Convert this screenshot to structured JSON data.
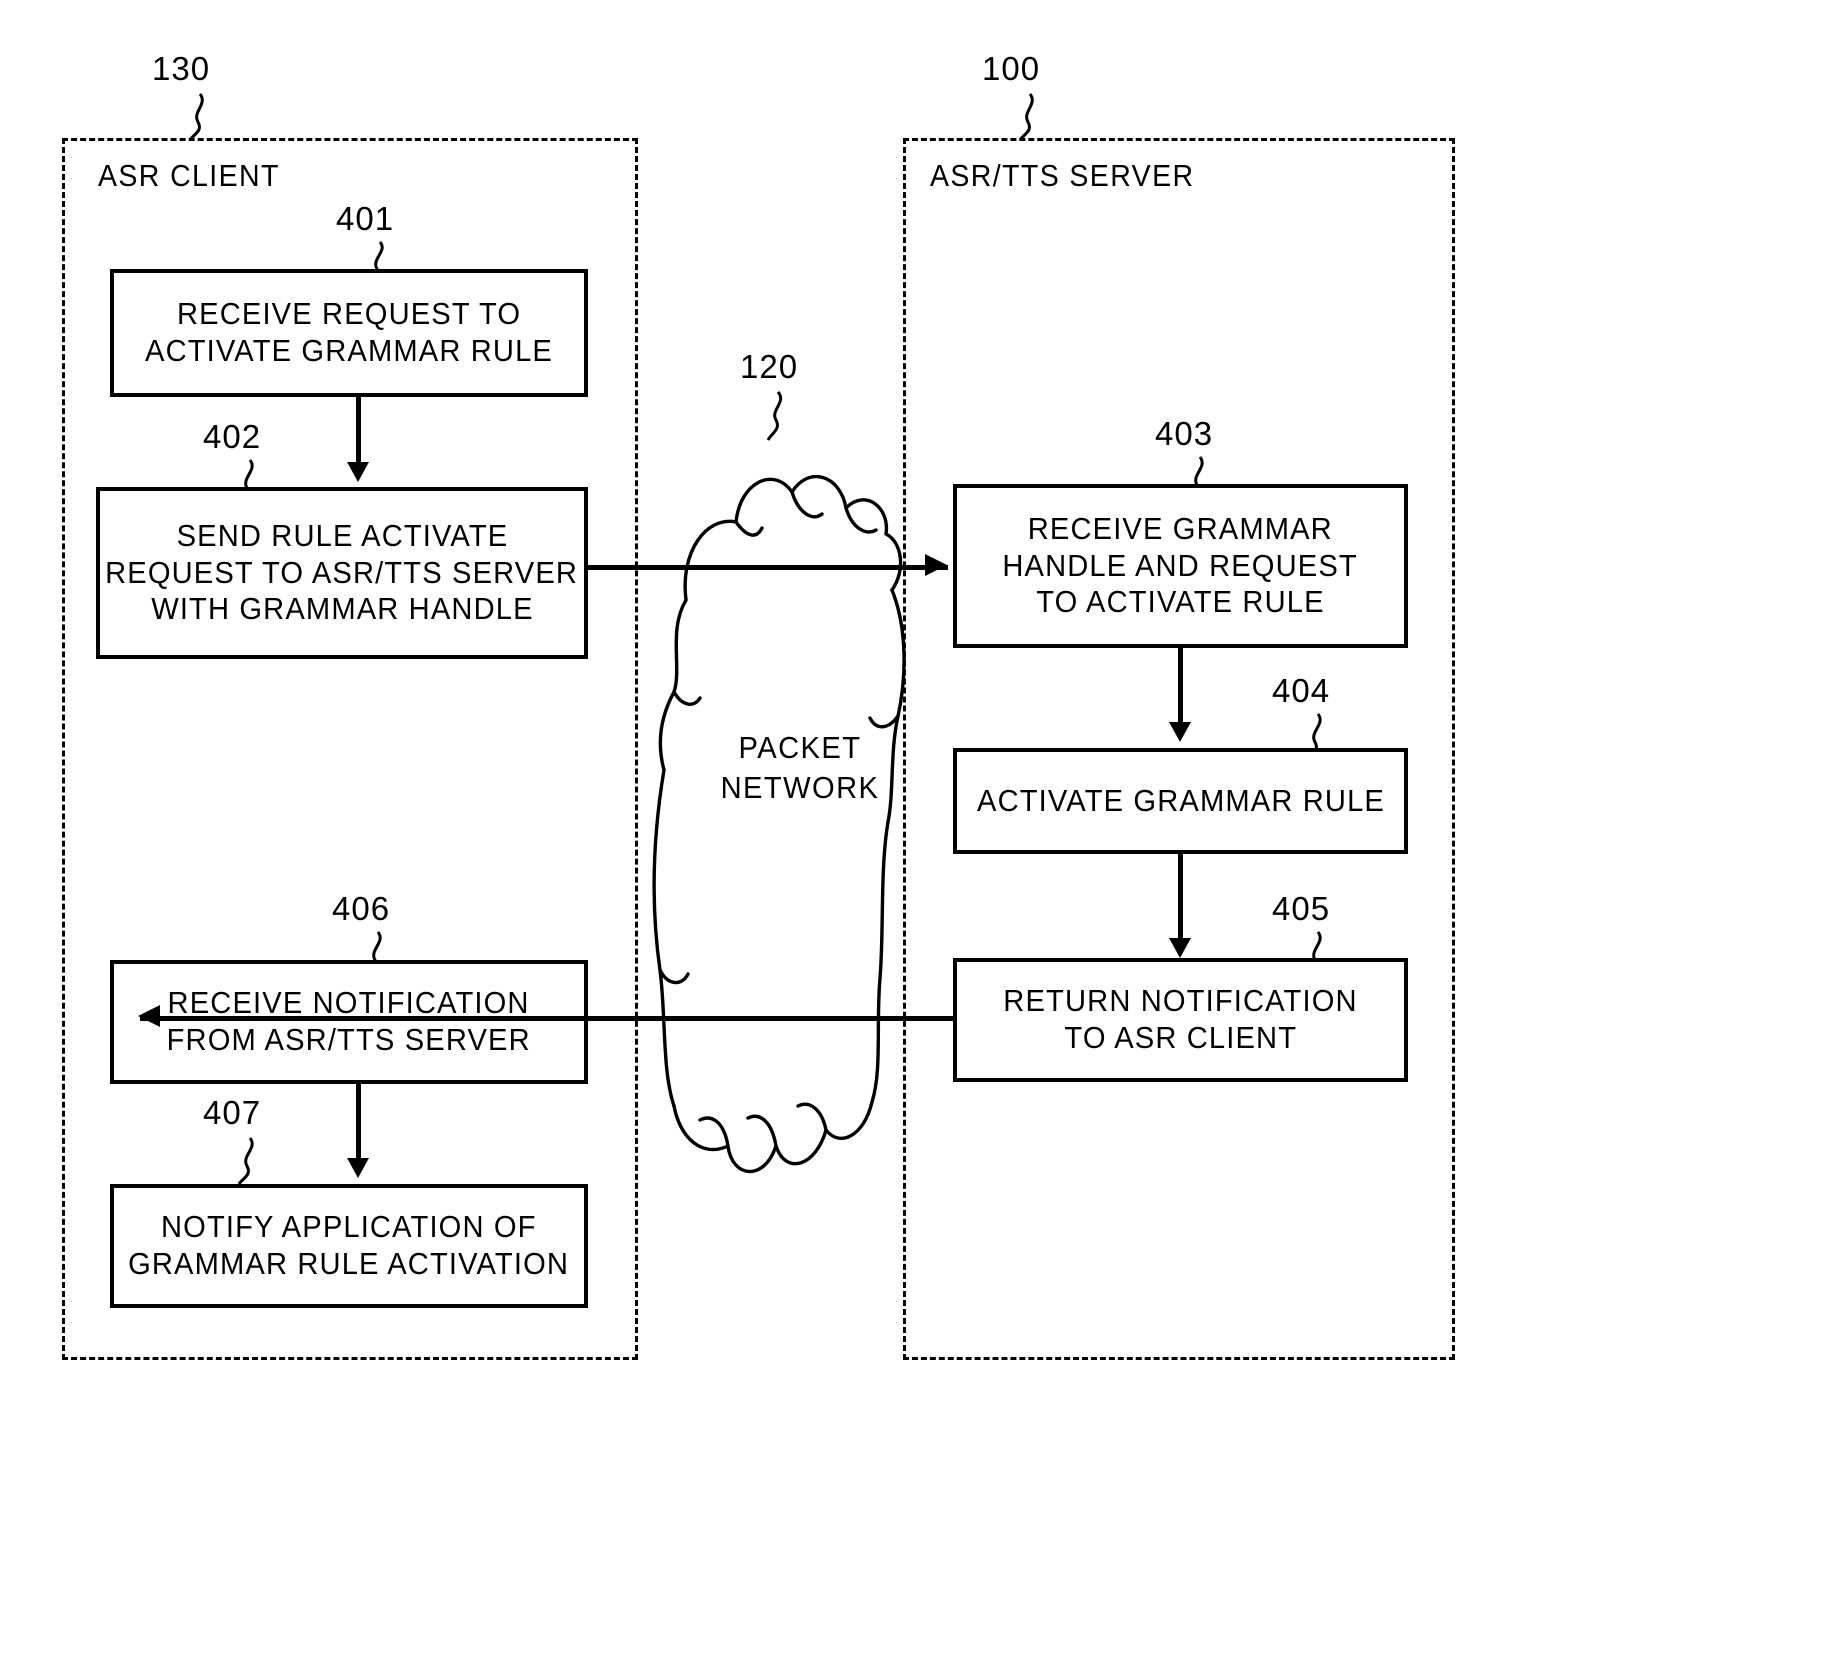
{
  "figure": {
    "type": "patent-flow-diagram",
    "domains": [
      {
        "id": "130",
        "ref_label": "130",
        "title": "ASR CLIENT"
      },
      {
        "id": "100",
        "ref_label": "100",
        "title": "ASR/TTS SERVER"
      }
    ],
    "network": {
      "ref_label": "120",
      "label_line1": "PACKET",
      "label_line2": "NETWORK"
    },
    "steps": {
      "s401": {
        "ref": "401",
        "line1": "RECEIVE REQUEST TO",
        "line2": "ACTIVATE GRAMMAR RULE"
      },
      "s402": {
        "ref": "402",
        "line1": "SEND RULE ACTIVATE",
        "line2": "REQUEST TO ASR/TTS SERVER",
        "line3": "WITH GRAMMAR HANDLE"
      },
      "s403": {
        "ref": "403",
        "line1": "RECEIVE GRAMMAR",
        "line2": "HANDLE AND REQUEST",
        "line3": "TO ACTIVATE RULE"
      },
      "s404": {
        "ref": "404",
        "line1": "ACTIVATE GRAMMAR RULE"
      },
      "s405": {
        "ref": "405",
        "line1": "RETURN NOTIFICATION",
        "line2": "TO ASR CLIENT"
      },
      "s406": {
        "ref": "406",
        "line1": "RECEIVE NOTIFICATION",
        "line2": "FROM ASR/TTS SERVER"
      },
      "s407": {
        "ref": "407",
        "line1": "NOTIFY APPLICATION OF",
        "line2": "GRAMMAR RULE ACTIVATION"
      }
    },
    "colors": {
      "ink": "#000000",
      "paper": "#ffffff"
    }
  }
}
